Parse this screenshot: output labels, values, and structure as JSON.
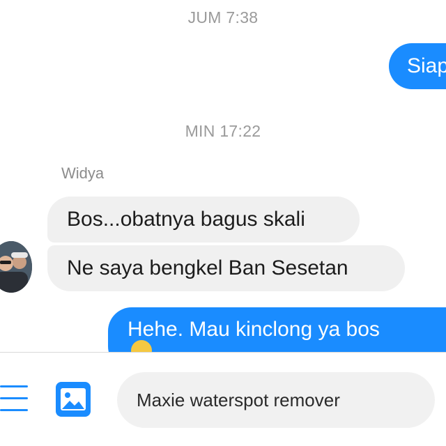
{
  "thread": {
    "messages": [
      {
        "kind": "timestamp",
        "text": "JUM 7:38"
      },
      {
        "kind": "outgoing",
        "text": "Siap"
      },
      {
        "kind": "timestamp",
        "text": "MIN 17:22"
      },
      {
        "kind": "sender",
        "text": "Widya"
      },
      {
        "kind": "incoming",
        "text": "Bos...obatnya bagus skali"
      },
      {
        "kind": "incoming",
        "text": "Ne saya bengkel Ban Sesetan"
      },
      {
        "kind": "outgoing",
        "text": "Hehe. Mau kinclong ya bos"
      }
    ]
  },
  "composer": {
    "input_value": "Maxie waterspot remover",
    "menu_icon": "menu-icon",
    "image_icon": "image-icon"
  },
  "colors": {
    "accent": "#1a8cff",
    "incoming_bubble": "#f0f0f0",
    "timestamp": "#9a9a9a",
    "input_bg": "#f1f1f1"
  }
}
